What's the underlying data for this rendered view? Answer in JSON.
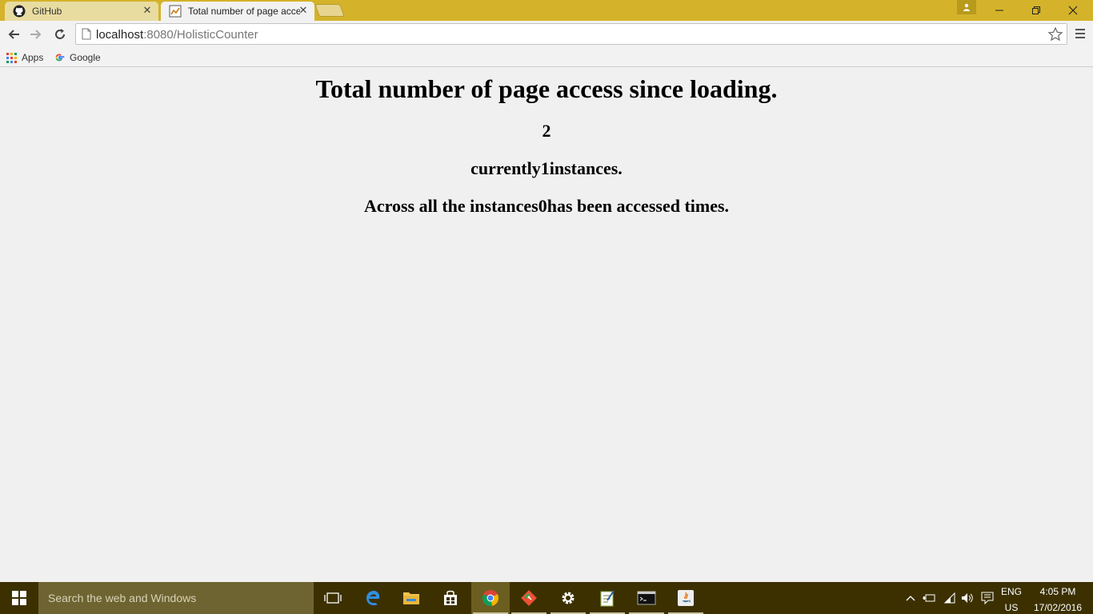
{
  "browser": {
    "tabs": [
      {
        "title": "GitHub"
      },
      {
        "title": "Total number of page access since loading."
      }
    ],
    "url_host": "localhost",
    "url_rest": ":8080/HolisticCounter",
    "bookmarks": [
      {
        "label": "Apps"
      },
      {
        "label": "Google"
      }
    ]
  },
  "page": {
    "heading": "Total number of page access since loading.",
    "count": "2",
    "instances_line": "currently1instances.",
    "across_line": "Across all the instances0has been accessed times."
  },
  "taskbar": {
    "search_placeholder": "Search the web and Windows",
    "apps": [
      "task-view",
      "edge",
      "file-explorer",
      "store",
      "chrome",
      "git",
      "settings",
      "notepad",
      "terminal",
      "java"
    ],
    "language": {
      "line1": "ENG",
      "line2": "US"
    },
    "clock": {
      "time": "4:05 PM",
      "date": "17/02/2016"
    }
  },
  "colors": {
    "titlebar": "#d4b32a",
    "taskbar": "#3c3000",
    "taskbar_search": "#6d6431"
  }
}
